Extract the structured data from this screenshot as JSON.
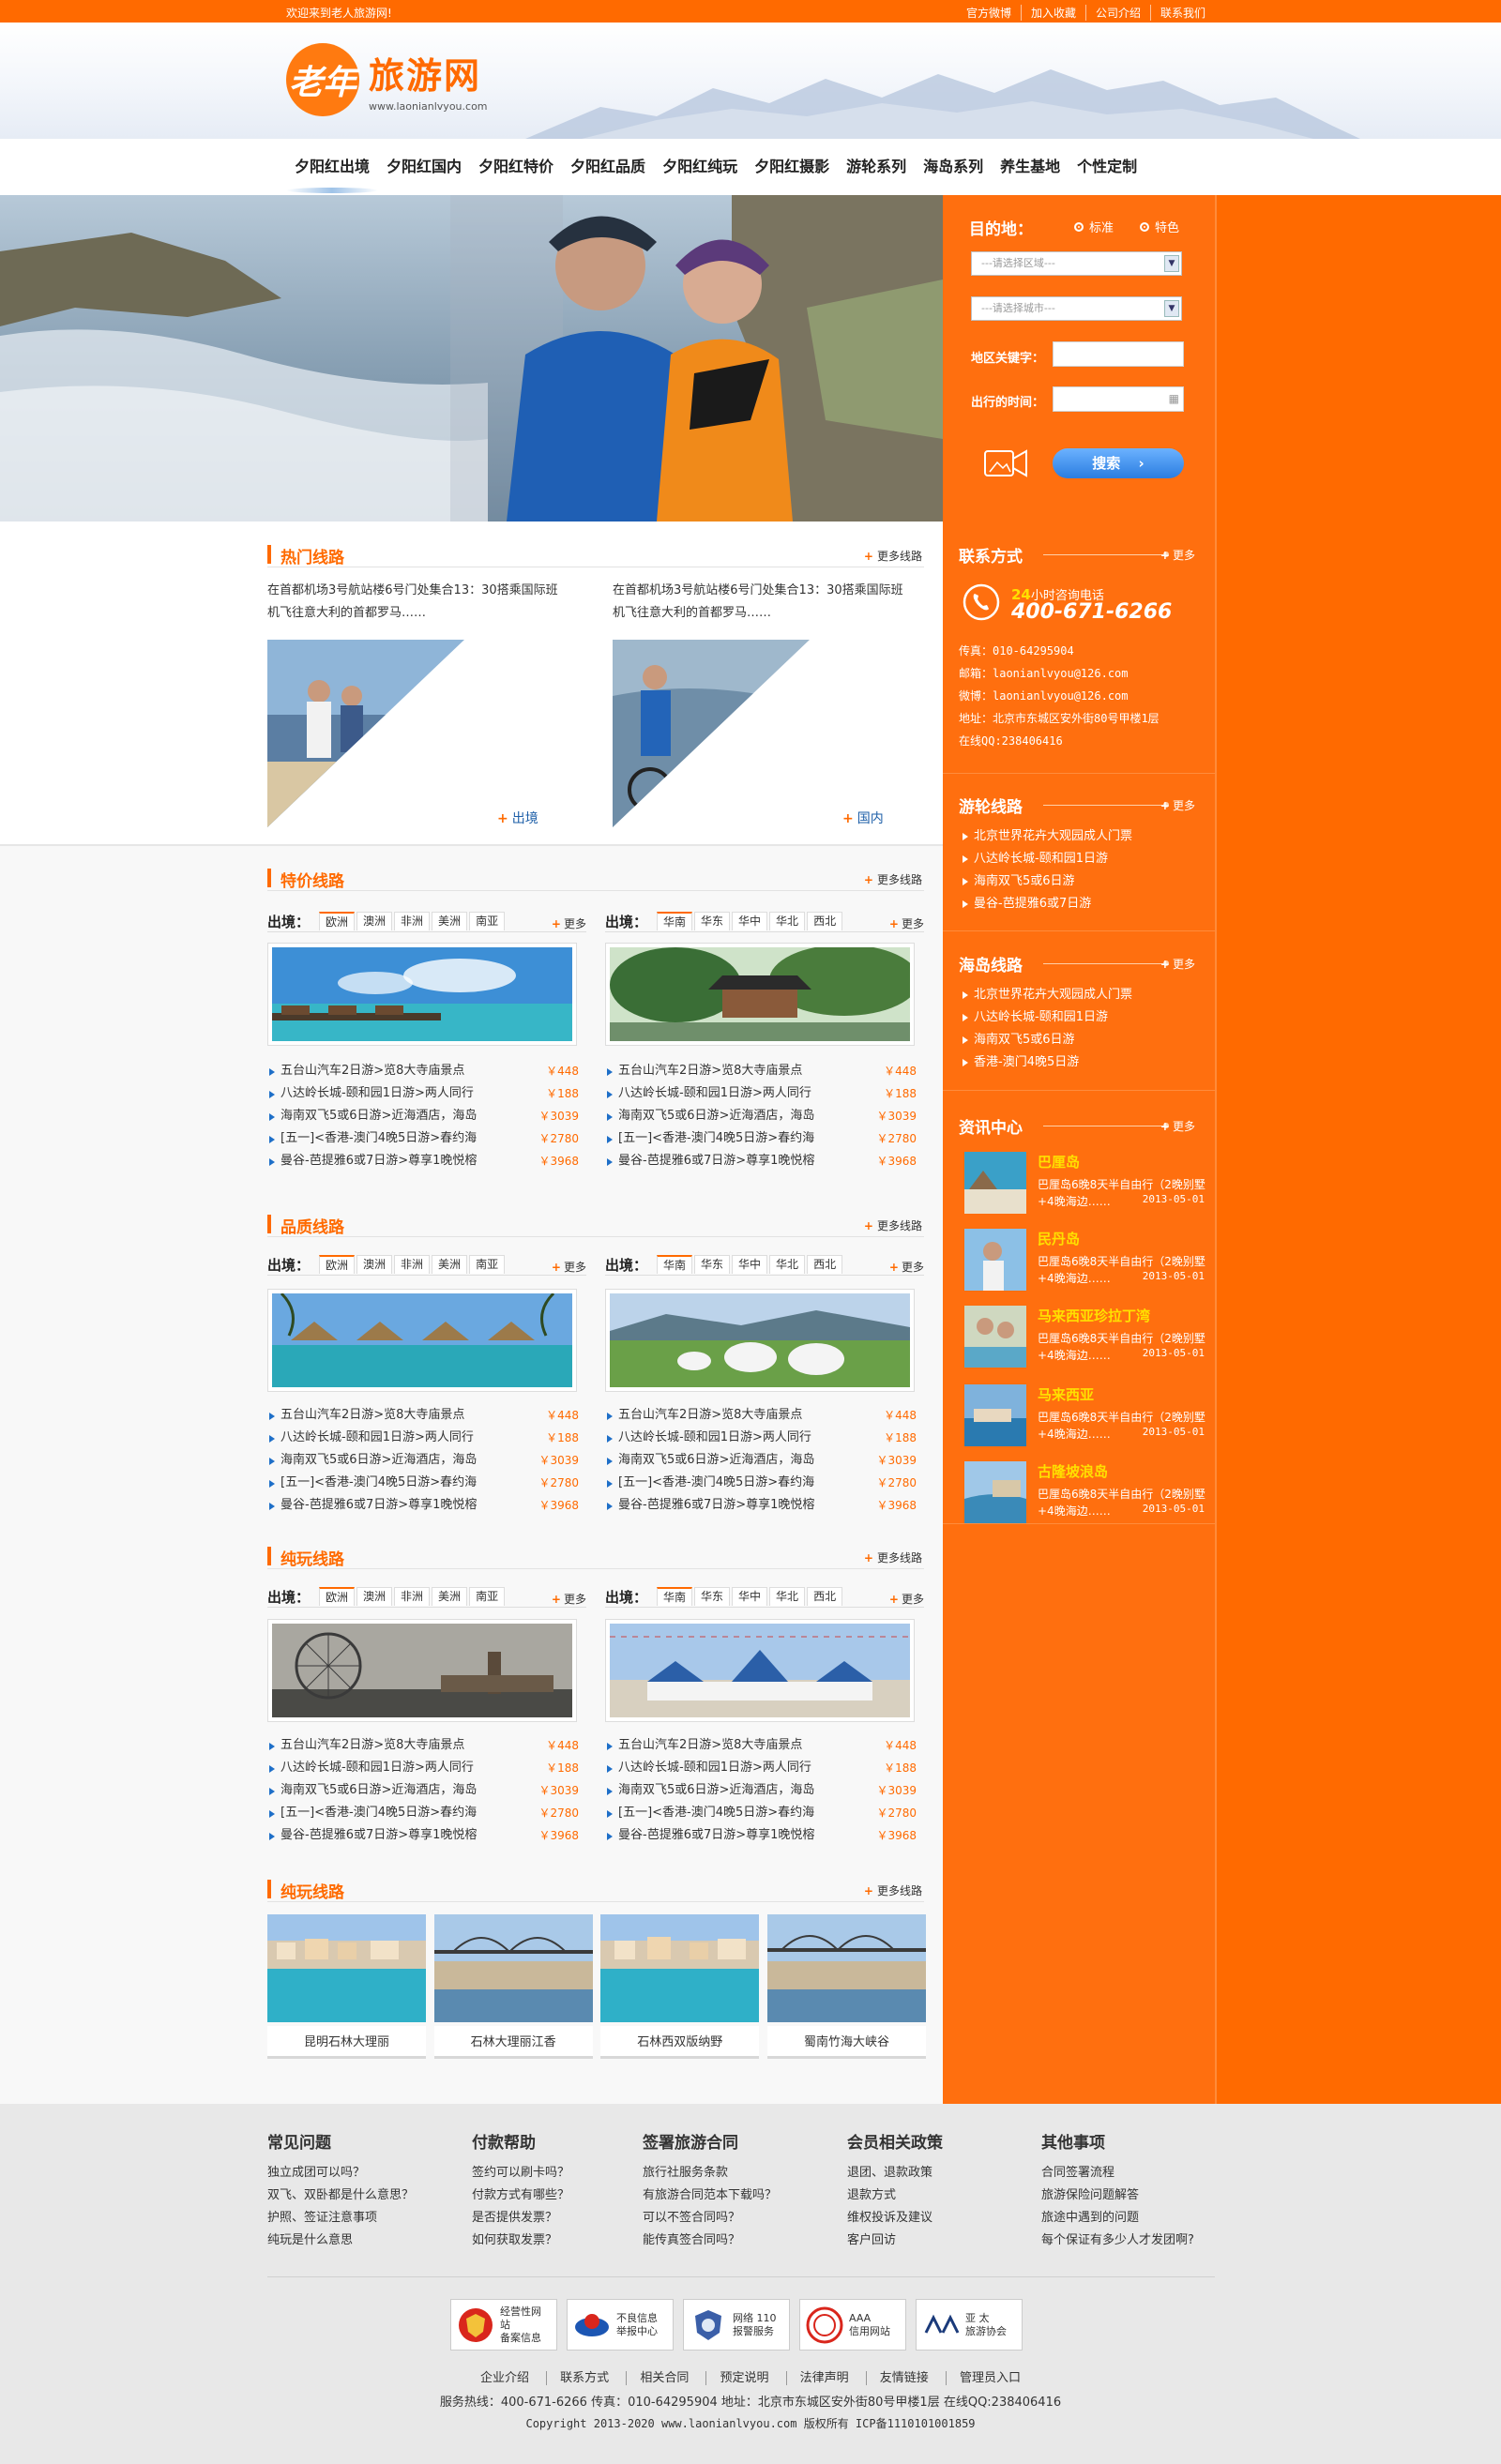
{
  "topbar": {
    "welcome": "欢迎来到老人旅游网!",
    "links": [
      "官方微博",
      "加入收藏",
      "公司介绍",
      "联系我们"
    ]
  },
  "logo": {
    "mark": "老年",
    "name": "旅游网",
    "url": "www.laonianlvyou.com"
  },
  "nav": [
    "夕阳红出境",
    "夕阳红国内",
    "夕阳红特价",
    "夕阳红品质",
    "夕阳红纯玩",
    "夕阳红摄影",
    "游轮系列",
    "海岛系列",
    "养生基地",
    "个性定制"
  ],
  "search": {
    "dest_label": "目的地：",
    "radio_standard": "标准",
    "radio_special": "特色",
    "region_placeholder": "---请选择区域---",
    "city_placeholder": "---请选择城市---",
    "keyword_label": "地区关键字：",
    "date_label": "出行的时间：",
    "button": "搜索"
  },
  "hot": {
    "title": "热门线路",
    "more": "更多线路",
    "items": [
      {
        "text": "在首都机场3号航站楼6号门处集合13：30搭乘国际班机飞往意大利的首都罗马……",
        "tag": "出境"
      },
      {
        "text": "在首都机场3号航站楼6号门处集合13：30搭乘国际班机飞往意大利的首都罗马……",
        "tag": "国内"
      }
    ]
  },
  "tabs": {
    "out_label": "出境：",
    "in_label": "出境：",
    "out": [
      "欧洲",
      "澳洲",
      "非洲",
      "美洲",
      "南亚"
    ],
    "in": [
      "华南",
      "华东",
      "华中",
      "华北",
      "西北"
    ],
    "more": "更多"
  },
  "routes": [
    {
      "name": "五台山汽车2日游>览8大寺庙景点",
      "price": "￥448"
    },
    {
      "name": "八达岭长城-颐和园1日游>两人同行",
      "price": "￥188"
    },
    {
      "name": "海南双飞5或6日游>近海酒店，海岛",
      "price": "￥3039"
    },
    {
      "name": "[五一]<香港-澳门4晚5日游>春约海",
      "price": "￥2780"
    },
    {
      "name": "曼谷-芭提雅6或7日游>尊享1晚悦榕",
      "price": "￥3968"
    }
  ],
  "sections": {
    "special": "特价线路",
    "quality": "品质线路",
    "pure": "纯玩线路",
    "pure2": "纯玩线路",
    "more": "更多线路"
  },
  "gallery": [
    "昆明石林大理丽",
    "石林大理丽江香",
    "石林西双版纳野",
    "蜀南竹海大峡谷"
  ],
  "contact": {
    "title": "联系方式",
    "more": "更多",
    "hotline_prefix": "24",
    "hotline_label": "小时咨询电话",
    "phone": "400-671-6266",
    "lines": [
      "传真：010-64295904",
      "邮箱：laonianlvyou@126.com",
      "微博：laonianlvyou@126.com",
      "地址：北京市东城区安外街80号甲楼1层",
      "在线QQ:238406416"
    ]
  },
  "cruise": {
    "title": "游轮线路",
    "more": "更多",
    "items": [
      "北京世界花卉大观园成人门票",
      "八达岭长城-颐和园1日游",
      "海南双飞5或6日游",
      "曼谷-芭提雅6或7日游"
    ]
  },
  "island": {
    "title": "海岛线路",
    "more": "更多",
    "items": [
      "北京世界花卉大观园成人门票",
      "八达岭长城-颐和园1日游",
      "海南双飞5或6日游",
      "香港-澳门4晚5日游"
    ]
  },
  "news": {
    "title": "资讯中心",
    "more": "更多",
    "items": [
      {
        "title": "巴厘岛",
        "desc": "巴厘岛6晚8天半自由行（2晚别墅+4晚海边……",
        "date": "2013-05-01"
      },
      {
        "title": "民丹岛",
        "desc": "巴厘岛6晚8天半自由行（2晚别墅+4晚海边……",
        "date": "2013-05-01"
      },
      {
        "title": "马来西亚珍拉丁湾",
        "desc": "巴厘岛6晚8天半自由行（2晚别墅+4晚海边……",
        "date": "2013-05-01"
      },
      {
        "title": "马来西亚",
        "desc": "巴厘岛6晚8天半自由行（2晚别墅+4晚海边……",
        "date": "2013-05-01"
      },
      {
        "title": "古隆坡浪岛",
        "desc": "巴厘岛6晚8天半自由行（2晚别墅+4晚海边……",
        "date": "2013-05-01"
      }
    ]
  },
  "footer": {
    "cols": [
      {
        "head": "常见问题",
        "items": [
          "独立成团可以吗？",
          "双飞、双卧都是什么意思？",
          "护照、签证注意事项",
          "纯玩是什么意思"
        ]
      },
      {
        "head": "付款帮助",
        "items": [
          "签约可以刷卡吗？",
          "付款方式有哪些？",
          "是否提供发票？",
          "如何获取发票？"
        ]
      },
      {
        "head": "签署旅游合同",
        "items": [
          "旅行社服务条款",
          "有旅游合同范本下载吗？",
          "可以不签合同吗？",
          "能传真签合同吗？"
        ]
      },
      {
        "head": "会员相关政策",
        "items": [
          "退团、退款政策",
          "退款方式",
          "维权投诉及建议",
          "客户回访"
        ]
      },
      {
        "head": "其他事项",
        "items": [
          "合同签署流程",
          "旅游保险问题解答",
          "旅途中遇到的问题",
          "每个保证有多少人才发团啊?"
        ]
      }
    ],
    "badges": [
      {
        "l1": "经营性网站",
        "l2": "备案信息"
      },
      {
        "l1": "不良信息",
        "l2": "举报中心"
      },
      {
        "l1": "网络 110",
        "l2": "报警服务"
      },
      {
        "l1": "AAA",
        "l2": "信用网站"
      },
      {
        "l1": "亚 太",
        "l2": "旅游协会"
      }
    ],
    "links": [
      "企业介绍",
      "联系方式",
      "相关合同",
      "预定说明",
      "法律声明",
      "友情链接",
      "管理员入口"
    ],
    "line2": "服务热线：400-671-6266  传真：010-64295904  地址：北京市东城区安外街80号甲楼1层  在线QQ:238406416",
    "line3": "Copyright  2013-2020  www.laonianlvyou.com 版权所有  ICP备1110101001859"
  }
}
